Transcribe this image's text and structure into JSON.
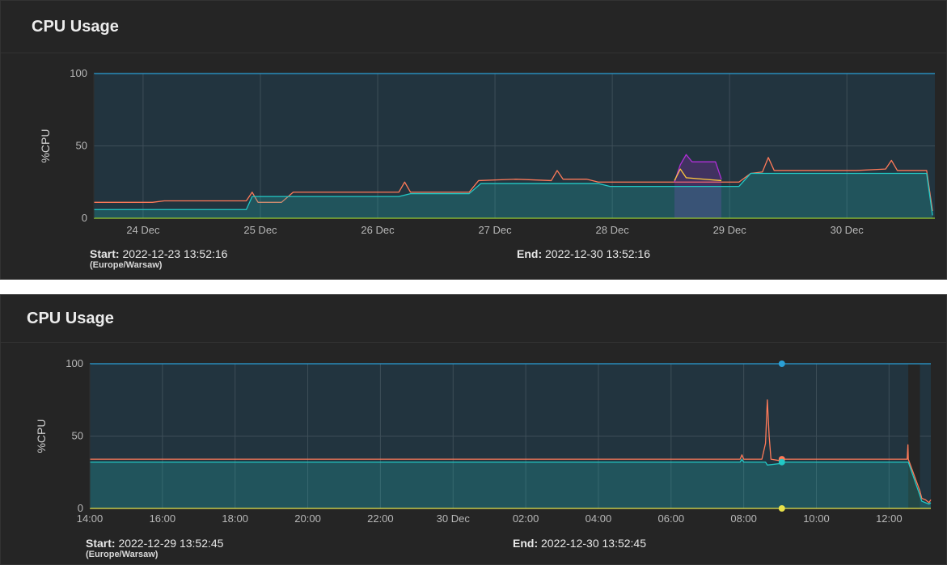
{
  "charts": [
    {
      "title": "CPU Usage",
      "ylabel": "%CPU",
      "start_label": "Start:",
      "start_value": "2022-12-23 13:52:16",
      "timezone": "(Europe/Warsaw)",
      "end_label": "End:",
      "end_value": "2022-12-30 13:52:16"
    },
    {
      "title": "CPU Usage",
      "ylabel": "%CPU",
      "start_label": "Start:",
      "start_value": "2022-12-29 13:52:45",
      "timezone": "(Europe/Warsaw)",
      "end_label": "End:",
      "end_value": "2022-12-30 13:52:45"
    }
  ],
  "chart_data": [
    {
      "type": "area",
      "title": "CPU Usage",
      "ylabel": "%CPU",
      "xlabel": "",
      "ylim": [
        0,
        100
      ],
      "yticks": [
        0,
        50,
        100
      ],
      "x_range": [
        0,
        7.17
      ],
      "xticks": [
        {
          "x": 0.42,
          "label": "24 Dec"
        },
        {
          "x": 1.42,
          "label": "25 Dec"
        },
        {
          "x": 2.42,
          "label": "26 Dec"
        },
        {
          "x": 3.42,
          "label": "27 Dec"
        },
        {
          "x": 4.42,
          "label": "28 Dec"
        },
        {
          "x": 5.42,
          "label": "29 Dec"
        },
        {
          "x": 6.42,
          "label": "30 Dec"
        }
      ],
      "series": [
        {
          "color": "#2a9fd6",
          "fill": false,
          "values": [
            [
              0,
              100
            ],
            [
              7.17,
              100
            ]
          ]
        },
        {
          "color": "#ff7a59",
          "fill": false,
          "values": [
            [
              0,
              11
            ],
            [
              0.5,
              11
            ],
            [
              0.6,
              12
            ],
            [
              1.3,
              12
            ],
            [
              1.35,
              18
            ],
            [
              1.4,
              11
            ],
            [
              1.6,
              11
            ],
            [
              1.7,
              18
            ],
            [
              2.6,
              18
            ],
            [
              2.65,
              25
            ],
            [
              2.7,
              18
            ],
            [
              3.2,
              18
            ],
            [
              3.28,
              26
            ],
            [
              3.6,
              27
            ],
            [
              3.9,
              26
            ],
            [
              3.95,
              33
            ],
            [
              4.0,
              27
            ],
            [
              4.2,
              27
            ],
            [
              4.3,
              25
            ],
            [
              5.5,
              25
            ],
            [
              5.6,
              31
            ],
            [
              5.7,
              32
            ],
            [
              5.75,
              42
            ],
            [
              5.8,
              33
            ],
            [
              6.5,
              33
            ],
            [
              6.75,
              34
            ],
            [
              6.8,
              40
            ],
            [
              6.85,
              33
            ],
            [
              7.1,
              33
            ],
            [
              7.15,
              5
            ]
          ]
        },
        {
          "color": "#b02fd8",
          "fill": true,
          "values": [
            [
              4.95,
              25
            ],
            [
              5.0,
              37
            ],
            [
              5.05,
              44
            ],
            [
              5.1,
              39
            ],
            [
              5.3,
              39
            ],
            [
              5.35,
              27
            ]
          ]
        },
        {
          "color": "#ffc83d",
          "fill": false,
          "values": [
            [
              4.95,
              26
            ],
            [
              5.0,
              34
            ],
            [
              5.05,
              28
            ],
            [
              5.35,
              26
            ]
          ]
        },
        {
          "color": "#22c9c6",
          "fill": true,
          "values": [
            [
              0,
              6
            ],
            [
              1.3,
              6
            ],
            [
              1.35,
              15
            ],
            [
              2.6,
              15
            ],
            [
              2.7,
              17
            ],
            [
              3.2,
              17
            ],
            [
              3.3,
              24
            ],
            [
              4.3,
              24
            ],
            [
              4.4,
              22
            ],
            [
              5.5,
              22
            ],
            [
              5.6,
              31
            ],
            [
              6.5,
              31
            ],
            [
              7.1,
              31
            ],
            [
              7.15,
              2
            ]
          ]
        },
        {
          "color": "#9acd32",
          "fill": false,
          "values": [
            [
              0,
              0
            ],
            [
              7.17,
              0
            ]
          ]
        }
      ]
    },
    {
      "type": "area",
      "title": "CPU Usage",
      "ylabel": "%CPU",
      "xlabel": "",
      "ylim": [
        0,
        100
      ],
      "yticks": [
        0,
        50,
        100
      ],
      "x_range": [
        14,
        37.15
      ],
      "xticks": [
        {
          "x": 14,
          "label": "14:00"
        },
        {
          "x": 16,
          "label": "16:00"
        },
        {
          "x": 18,
          "label": "18:00"
        },
        {
          "x": 20,
          "label": "20:00"
        },
        {
          "x": 22,
          "label": "22:00"
        },
        {
          "x": 24,
          "label": "30 Dec"
        },
        {
          "x": 26,
          "label": "02:00"
        },
        {
          "x": 28,
          "label": "04:00"
        },
        {
          "x": 30,
          "label": "06:00"
        },
        {
          "x": 32,
          "label": "08:00"
        },
        {
          "x": 34,
          "label": "10:00"
        },
        {
          "x": 36,
          "label": "12:00"
        }
      ],
      "gap_range": [
        36.53,
        36.85
      ],
      "hover_x": 33.05,
      "hover_values": [
        100,
        34,
        32,
        0
      ],
      "series": [
        {
          "color": "#2a9fd6",
          "fill": false,
          "values": [
            [
              14,
              100
            ],
            [
              36.53,
              100
            ],
            [
              36.85,
              100
            ],
            [
              37.15,
              100
            ]
          ]
        },
        {
          "color": "#ff7a59",
          "fill": false,
          "values": [
            [
              14,
              34
            ],
            [
              20,
              34
            ],
            [
              24,
              34
            ],
            [
              28,
              34
            ],
            [
              31.9,
              34
            ],
            [
              31.95,
              37
            ],
            [
              32.0,
              34
            ],
            [
              32.5,
              34
            ],
            [
              32.6,
              45
            ],
            [
              32.65,
              75
            ],
            [
              32.7,
              50
            ],
            [
              32.75,
              34
            ],
            [
              33.0,
              33
            ],
            [
              33.1,
              34
            ],
            [
              36.4,
              34
            ],
            [
              36.5,
              34
            ],
            [
              36.52,
              44
            ],
            [
              36.53,
              34
            ],
            [
              36.85,
              12
            ],
            [
              36.9,
              7
            ],
            [
              37.0,
              6
            ],
            [
              37.1,
              4
            ],
            [
              37.15,
              6
            ]
          ]
        },
        {
          "color": "#22c9c6",
          "fill": true,
          "values": [
            [
              14,
              32
            ],
            [
              20,
              32
            ],
            [
              24,
              32
            ],
            [
              28,
              32
            ],
            [
              31.9,
              32
            ],
            [
              31.95,
              34
            ],
            [
              32.0,
              32
            ],
            [
              32.6,
              32
            ],
            [
              32.65,
              30
            ],
            [
              33.0,
              31
            ],
            [
              33.1,
              32
            ],
            [
              36.5,
              32
            ],
            [
              36.53,
              32
            ],
            [
              36.85,
              9
            ],
            [
              36.9,
              5
            ],
            [
              37.0,
              4
            ],
            [
              37.1,
              3
            ],
            [
              37.15,
              4
            ]
          ]
        },
        {
          "color": "#e8e24a",
          "fill": false,
          "values": [
            [
              14,
              0
            ],
            [
              36.53,
              0
            ],
            [
              36.85,
              0
            ],
            [
              37.15,
              0
            ]
          ]
        }
      ]
    }
  ]
}
